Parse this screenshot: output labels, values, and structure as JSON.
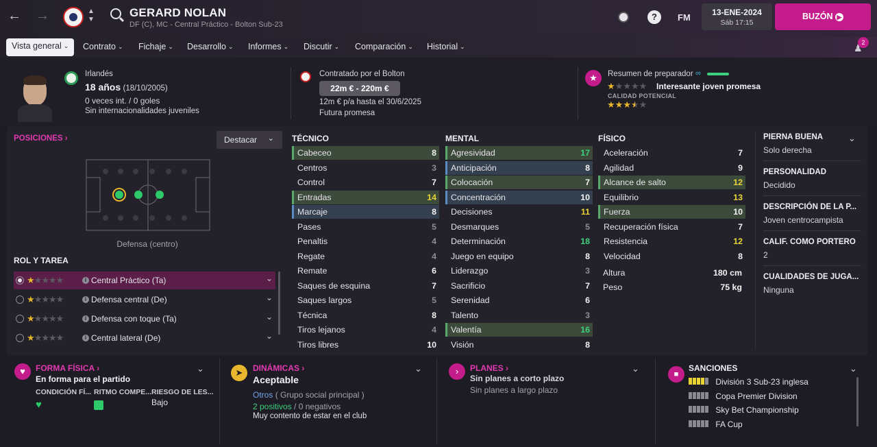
{
  "header": {
    "player_name": "GERARD NOLAN",
    "player_subtitle": "DF (C), MC - Central Práctico - Bolton Sub-23",
    "fm_label": "FM",
    "date": "13-ENE-2024",
    "time": "Sáb 17:15",
    "buzon_label": "BUZÓN",
    "notif_count": "2"
  },
  "menu": {
    "items": [
      "Vista general",
      "Contrato",
      "Fichaje",
      "Desarrollo",
      "Informes",
      "Discutir",
      "Comparación",
      "Historial"
    ]
  },
  "profile": {
    "nationality": "Irlandés",
    "age": "18 años",
    "birthdate": "(18/10/2005)",
    "caps": "0 veces int. / 0 goles",
    "youth_caps": "Sin internacionalidades juveniles",
    "contract_by": "Contratado por el Bolton",
    "value_range": "22m € - 220m €",
    "wage": "12m € p/a hasta el 30/6/2025",
    "status": "Futura promesa",
    "coach_summary_title": "Resumen de preparador",
    "coach_summary_text": "Interesante joven promesa",
    "potential_label": "CALIDAD POTENCIAL",
    "current_stars": 1,
    "potential_stars": 3.5
  },
  "positions": {
    "title": "POSICIONES",
    "highlight_label": "Destacar",
    "pitch_caption": "Defensa (centro)"
  },
  "roles": {
    "title": "ROL Y TAREA",
    "items": [
      {
        "label": "Central Práctico (Ta)",
        "stars": 1,
        "active": true
      },
      {
        "label": "Defensa central (De)",
        "stars": 1,
        "active": false
      },
      {
        "label": "Defensa con toque (Ta)",
        "stars": 1,
        "active": false
      },
      {
        "label": "Central lateral (De)",
        "stars": 1,
        "active": false
      }
    ]
  },
  "attributes": {
    "technical": {
      "title": "TÉCNICO",
      "rows": [
        {
          "name": "Cabeceo",
          "value": "8",
          "hl": "green",
          "color": "white"
        },
        {
          "name": "Centros",
          "value": "3",
          "hl": "",
          "color": "gray"
        },
        {
          "name": "Control",
          "value": "7",
          "hl": "",
          "color": "white"
        },
        {
          "name": "Entradas",
          "value": "14",
          "hl": "green",
          "color": "yellow"
        },
        {
          "name": "Marcaje",
          "value": "8",
          "hl": "blue",
          "color": "white"
        },
        {
          "name": "Pases",
          "value": "5",
          "hl": "",
          "color": "gray"
        },
        {
          "name": "Penaltis",
          "value": "4",
          "hl": "",
          "color": "gray"
        },
        {
          "name": "Regate",
          "value": "4",
          "hl": "",
          "color": "gray"
        },
        {
          "name": "Remate",
          "value": "6",
          "hl": "",
          "color": "white"
        },
        {
          "name": "Saques de esquina",
          "value": "7",
          "hl": "",
          "color": "white"
        },
        {
          "name": "Saques largos",
          "value": "5",
          "hl": "",
          "color": "gray"
        },
        {
          "name": "Técnica",
          "value": "8",
          "hl": "",
          "color": "white"
        },
        {
          "name": "Tiros lejanos",
          "value": "4",
          "hl": "",
          "color": "gray"
        },
        {
          "name": "Tiros libres",
          "value": "10",
          "hl": "",
          "color": "white"
        }
      ]
    },
    "mental": {
      "title": "MENTAL",
      "rows": [
        {
          "name": "Agresividad",
          "value": "17",
          "hl": "green",
          "color": "green"
        },
        {
          "name": "Anticipación",
          "value": "8",
          "hl": "blue",
          "color": "white"
        },
        {
          "name": "Colocación",
          "value": "7",
          "hl": "green",
          "color": "white"
        },
        {
          "name": "Concentración",
          "value": "10",
          "hl": "blue",
          "color": "white"
        },
        {
          "name": "Decisiones",
          "value": "11",
          "hl": "",
          "color": "yellow"
        },
        {
          "name": "Desmarques",
          "value": "5",
          "hl": "",
          "color": "gray"
        },
        {
          "name": "Determinación",
          "value": "18",
          "hl": "",
          "color": "green"
        },
        {
          "name": "Juego en equipo",
          "value": "8",
          "hl": "",
          "color": "white"
        },
        {
          "name": "Liderazgo",
          "value": "3",
          "hl": "",
          "color": "gray"
        },
        {
          "name": "Sacrificio",
          "value": "7",
          "hl": "",
          "color": "white"
        },
        {
          "name": "Serenidad",
          "value": "6",
          "hl": "",
          "color": "white"
        },
        {
          "name": "Talento",
          "value": "3",
          "hl": "",
          "color": "gray"
        },
        {
          "name": "Valentía",
          "value": "16",
          "hl": "green",
          "color": "green"
        },
        {
          "name": "Visión",
          "value": "8",
          "hl": "",
          "color": "white"
        }
      ]
    },
    "physical": {
      "title": "FÍSICO",
      "rows": [
        {
          "name": "Aceleración",
          "value": "7",
          "hl": "",
          "color": "white"
        },
        {
          "name": "Agilidad",
          "value": "9",
          "hl": "",
          "color": "white"
        },
        {
          "name": "Alcance de salto",
          "value": "12",
          "hl": "green",
          "color": "yellow"
        },
        {
          "name": "Equilibrio",
          "value": "13",
          "hl": "",
          "color": "yellow"
        },
        {
          "name": "Fuerza",
          "value": "10",
          "hl": "green",
          "color": "white"
        },
        {
          "name": "Recuperación física",
          "value": "7",
          "hl": "",
          "color": "white"
        },
        {
          "name": "Resistencia",
          "value": "12",
          "hl": "",
          "color": "yellow"
        },
        {
          "name": "Velocidad",
          "value": "8",
          "hl": "",
          "color": "white"
        }
      ],
      "height_label": "Altura",
      "height": "180 cm",
      "weight_label": "Peso",
      "weight": "75 kg"
    }
  },
  "side_info": [
    {
      "title": "PIERNA BUENA",
      "value": "Solo derecha"
    },
    {
      "title": "PERSONALIDAD",
      "value": "Decidido"
    },
    {
      "title": "DESCRIPCIÓN DE LA P...",
      "value": "Joven centrocampista"
    },
    {
      "title": "CALIF. COMO PORTERO",
      "value": "2"
    },
    {
      "title": "CUALIDADES DE JUGA...",
      "value": "Ninguna"
    }
  ],
  "bottom": {
    "fitness": {
      "title": "FORMA FÍSICA",
      "status": "En forma para el partido",
      "col1": "CONDICIÓN FÍ...",
      "col2": "RITMO COMPE...",
      "col3": "RIESGO DE LES...",
      "risk_value": "Bajo"
    },
    "dynamics": {
      "title": "DINÁMICAS",
      "status": "Aceptable",
      "group": "Otros",
      "group_note": "( Grupo social principal )",
      "positives": "2 positivos",
      "sep": "/",
      "negatives": "0 negativos",
      "note": "Muy contento de estar en el club"
    },
    "plans": {
      "title": "PLANES",
      "short": "Sin planes a corto plazo",
      "long": "Sin planes a largo plazo"
    },
    "sanctions": {
      "title": "SANCIONES",
      "items": [
        "División 3 Sub-23 inglesa",
        "Copa Premier Division",
        "Sky Bet Championship",
        "FA Cup"
      ]
    }
  },
  "colors": {
    "accent": "#c41d8b",
    "highlight_green": "#3c4a3b",
    "highlight_blue": "#34404f",
    "value_green": "#3ed07c",
    "value_yellow": "#e8d534"
  }
}
